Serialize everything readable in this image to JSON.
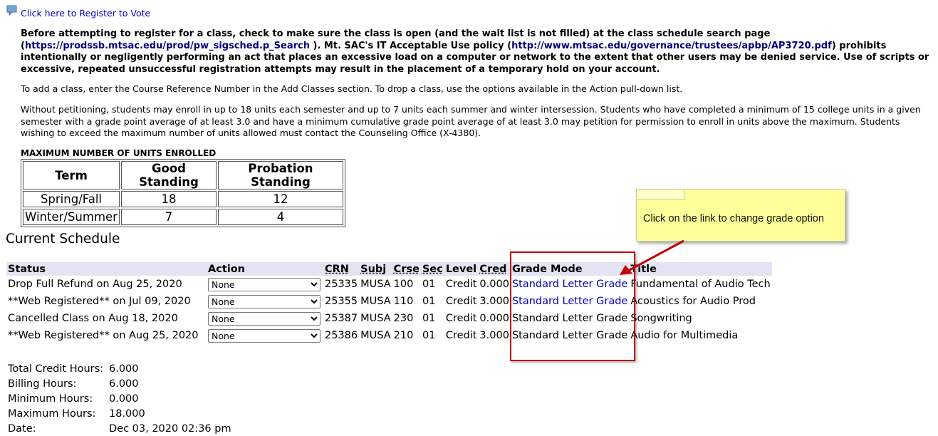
{
  "register": {
    "link": "Click here to Register to Vote"
  },
  "notice": {
    "p1": "Before attempting to register for a class, check to make sure the class is open (and the wait list is not filled) at the class schedule search page (",
    "link1": "https://prodssb.mtsac.edu/prod/pw_sigsched.p_Search",
    "p2": " ). Mt. SAC's IT Acceptable Use policy (",
    "link2": "http://www.mtsac.edu/governance/trustees/apbp/AP3720.pdf",
    "p3": ") prohibits intentionally or negligently performing an act that places an excessive load on a computer or network to the extent that other users may be denied service. Use of scripts or excessive, repeated unsuccessful registration attempts may result in the placement of a temporary hold on your account."
  },
  "add_drop_text": "To add a class, enter the Course Reference Number in the Add Classes section. To drop a class, use the options available in the Action pull-down list.",
  "units_text": "Without petitioning, students may enroll in up to 18 units each semester and up to 7 units each summer and winter intersession. Students who have completed a minimum of 15 college units in a given semester with a grade point average of at least 3.0 and have a minimum cumulative grade point average of at least 3.0 may petition for permission to enroll in units above the maximum. Students wishing to exceed the maximum number of units allowed must contact the Counseling Office (X-4380).",
  "max_units": {
    "title": "MAXIMUM NUMBER OF UNITS ENROLLED",
    "headers": [
      "Term",
      "Good Standing",
      "Probation Standing"
    ],
    "rows": [
      [
        "Spring/Fall",
        "18",
        "12"
      ],
      [
        "Winter/Summer",
        "7",
        "4"
      ]
    ]
  },
  "schedule": {
    "heading": "Current Schedule",
    "headers": [
      "Status",
      "Action",
      "CRN",
      "Subj",
      "Crse",
      "Sec",
      "Level",
      "Cred",
      "Grade Mode",
      "Title"
    ],
    "rows": [
      {
        "status": "Drop Full Refund on Aug 25, 2020",
        "action": "None",
        "crn": "25335",
        "subj": "MUSA",
        "crse": "100",
        "sec": "01",
        "level": "Credit",
        "cred": "0.000",
        "grade": "Standard Letter Grade",
        "title": "Fundamental of Audio Tech"
      },
      {
        "status": "**Web Registered** on Jul 09, 2020",
        "action": "None",
        "crn": "25355",
        "subj": "MUSA",
        "crse": "110",
        "sec": "01",
        "level": "Credit",
        "cred": "3.000",
        "grade": "Standard Letter Grade",
        "title": "Acoustics for Audio Prod"
      },
      {
        "status": "Cancelled Class on Aug 18, 2020",
        "action": "None",
        "crn": "25387",
        "subj": "MUSA",
        "crse": "230",
        "sec": "01",
        "level": "Credit",
        "cred": "0.000",
        "grade": "Standard Letter Grade",
        "title": "Songwriting"
      },
      {
        "status": "**Web Registered** on Aug 25, 2020",
        "action": "None",
        "crn": "25386",
        "subj": "MUSA",
        "crse": "210",
        "sec": "01",
        "level": "Credit",
        "cred": "3.000",
        "grade": "Standard Letter Grade",
        "title": "Audio for Multimedia"
      }
    ]
  },
  "totals": [
    {
      "label": "Total Credit Hours:",
      "value": "6.000"
    },
    {
      "label": "Billing Hours:",
      "value": "6.000"
    },
    {
      "label": "Minimum Hours:",
      "value": "0.000"
    },
    {
      "label": "Maximum Hours:",
      "value": "18.000"
    },
    {
      "label": "Date:",
      "value": "Dec 03, 2020 02:36 pm"
    }
  ],
  "callout": {
    "text": "Click on the link to change grade option"
  },
  "colors": {
    "link": "#0000cc",
    "header_bg": "#e3e3f3",
    "callout_bg": "#ffff99",
    "highlight": "#c00000"
  },
  "icons": {
    "register": "speech-bubble-icon"
  }
}
